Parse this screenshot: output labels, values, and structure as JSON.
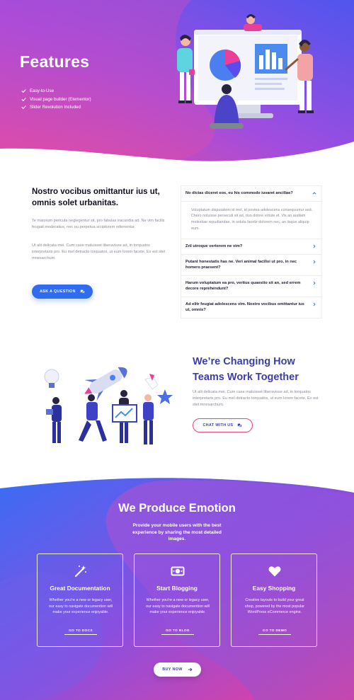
{
  "hero": {
    "title": "Features",
    "features": [
      "Easy-to-Use",
      "Visual page builder (Elementor)",
      "Slider Revolution Included"
    ],
    "colors": {
      "gradient_left": "#e84a9a",
      "gradient_mid": "#9b4de0",
      "gradient_right": "#5a4bec"
    }
  },
  "faq": {
    "heading": "Nostro vocibus omittantur ius ut, omnis solet urbanitas.",
    "paragraph1": "Te maiorum pericula neglegentur sit, pro fabulas iracundia ad. Ne vim facilis feugait moderatius, nec eu perpetua scriptorem referrentur.",
    "paragraph2": "Ut alii delicata mei. Cum case maluisset liberavisse ad, in torquatos interpretaris pro. Eu mel detracto torquatos, ut eum lorem facete. Ex est stet mnesarchum.",
    "button_label": "ASK A QUESTION",
    "accordion": [
      {
        "question": "No dictas diceret eos, eu his commodo iuvaret ancillae?",
        "open": true,
        "answer": "Voluptatum disputationi id mel, id postea adolescens consequuntur sed. Choro noluisse persecuti sit ad, duo dolore virtute et. Vix an audiam molestiae repudiandae, in soluta facete dolorem nec, an iisque aliquip eum."
      },
      {
        "question": "Zril utroque verterem ne vim?",
        "open": false
      },
      {
        "question": "Putant honestatis has ne. Veri animal facilisi ut pro, in nec homero praesent?",
        "open": false
      },
      {
        "question": "Harum voluptatum ea pro, veritus quaestio sit an, sed errem decore reprehendunt?",
        "open": false
      },
      {
        "question": "Ad elitr feugiat adolescens vim. Nostro vocibus omittantur ius ut, omnis?",
        "open": false
      }
    ]
  },
  "team": {
    "heading": "We’re Changing How Teams Work Together",
    "text": "Ut alii delicata mei. Cum case maluisset liberavisse ad, in torquatos interpretaris pro. Eu mel detracto torquatos, ut eum lorem facete. Ex est stet mnesarchum.",
    "button_label": "CHAT WITH US"
  },
  "emotion": {
    "title": "We Produce Emotion",
    "subtitle": "Provide your mobile users with the best experience by sharing the most detailed images.",
    "cards": [
      {
        "icon": "magic-wand-icon",
        "title": "Great Documentation",
        "text": "Whether you're a new or legacy user, our easy to navigate documention will make your experience enjoyable.",
        "link": "GO TO DOCS"
      },
      {
        "icon": "money-bill-icon",
        "title": "Start Blogging",
        "text": "Whether you're a new or legacy user, our easy to navigate documention will make your experience enjoyable.",
        "link": "GO TO BLOG"
      },
      {
        "icon": "heart-icon",
        "title": "Easy Shopping",
        "text": "Creative layouts to build your great shop, powered by the most popular WordPress eCommerce engine.",
        "link": "GO TO DEMO"
      }
    ],
    "button_label": "BUY NOW",
    "colors": {
      "blue": "#3a6cf4",
      "purple": "#7b4fe0",
      "pink": "#e8409a"
    }
  }
}
